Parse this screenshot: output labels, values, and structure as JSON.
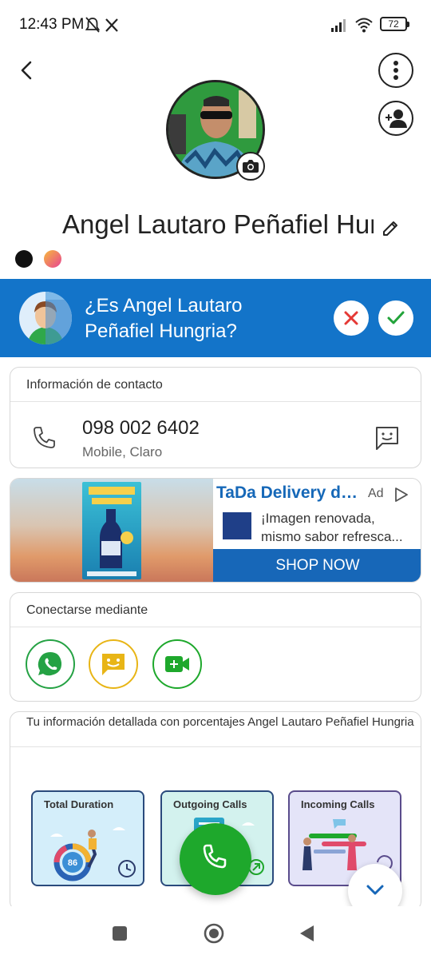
{
  "status_bar": {
    "time": "12:43 PM",
    "battery": "72"
  },
  "profile": {
    "name": "Angel Lautaro Peñafiel Hungria"
  },
  "banner": {
    "question": "¿Es Angel Lautaro Peñafiel Hungria?"
  },
  "contact_info": {
    "header": "Información de contacto",
    "phone_number": "098 002 6402",
    "phone_type": "Mobile, Claro"
  },
  "ad": {
    "title": "TaDa Delivery de...",
    "label": "Ad",
    "body": "¡Imagen renovada, mismo sabor refresca...",
    "cta": "SHOP NOW"
  },
  "connect": {
    "header": "Conectarse mediante"
  },
  "stats": {
    "header": "Tu información detallada con porcentajes Angel Lautaro Peñafiel Hungria",
    "cards": [
      {
        "title": "Total Duration",
        "value": "86"
      },
      {
        "title": "Outgoing Calls"
      },
      {
        "title": "Incoming Calls"
      }
    ]
  },
  "colors": {
    "brand_blue": "#1374c9",
    "call_green": "#1ea82c",
    "whatsapp_green": "#25a244",
    "sms_yellow": "#e8b516"
  }
}
